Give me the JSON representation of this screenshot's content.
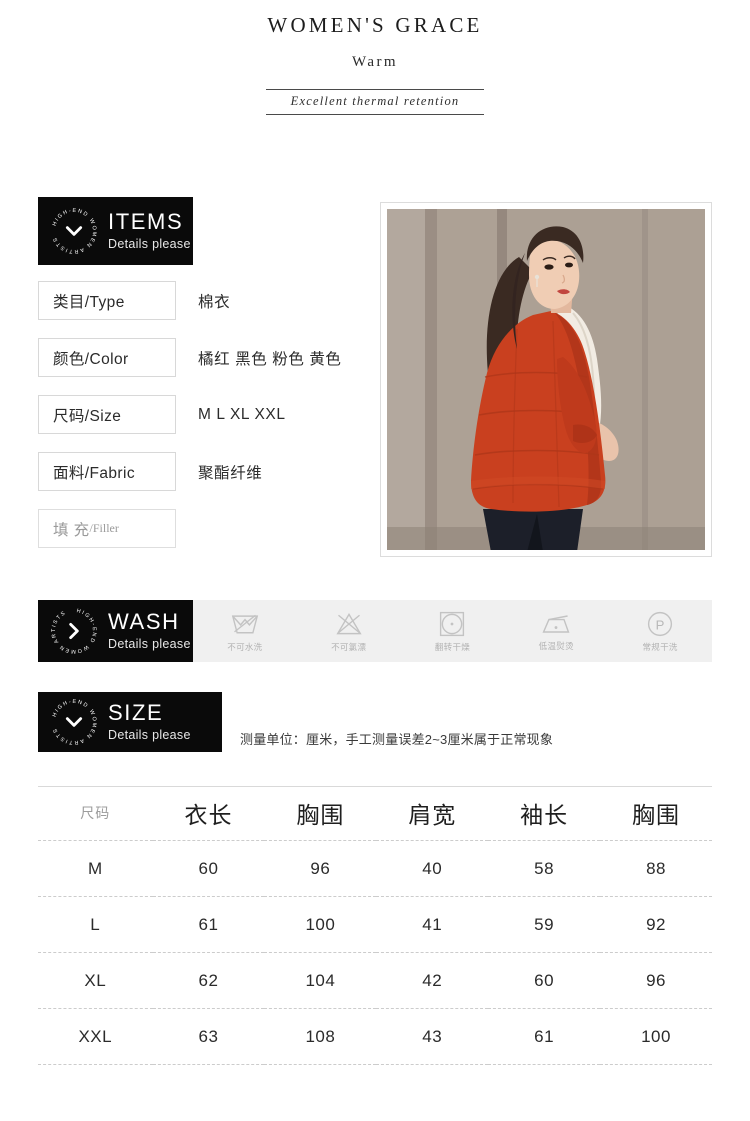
{
  "header": {
    "title": "WOMEN'S GRACE",
    "subtitle": "Warm",
    "tagline": "Excellent thermal retention"
  },
  "items": {
    "badge": {
      "title": "ITEMS",
      "subtitle": "Details please",
      "seal_text": "HIGH-END WOMEN ARTISTS",
      "icon": "chevron-down-icon"
    },
    "specs": [
      {
        "key": "类目/Type",
        "value": "棉衣"
      },
      {
        "key": "颜色/Color",
        "value": "橘红 黑色 粉色 黄色"
      },
      {
        "key": "尺码/Size",
        "value": "M L XL XXL"
      },
      {
        "key": "面料/Fabric",
        "value": "聚酯纤维"
      }
    ],
    "filler_row": {
      "key_cn": "填 充",
      "key_en": "/Filler",
      "value": ""
    }
  },
  "photo": {
    "alt": "model-wearing-orange-padded-jacket",
    "jacket_color": "#c9401f",
    "background_color": "#a89b90",
    "pants_color": "#1c1f29",
    "hair_color": "#3a2a22",
    "fur_color": "#f5f1ea"
  },
  "wash": {
    "badge": {
      "title": "WASH",
      "subtitle": "Details please",
      "seal_text": "HIGH-END WOMEN ARTISTS",
      "icon": "chevron-right-icon"
    },
    "icons": [
      {
        "name": "do-not-wash-icon",
        "label": "不可水洗"
      },
      {
        "name": "do-not-bleach-icon",
        "label": "不可氯漂"
      },
      {
        "name": "tumble-dry-icon",
        "label": "翻转干燥"
      },
      {
        "name": "low-temp-iron-icon",
        "label": "低温熨烫"
      },
      {
        "name": "dry-clean-p-icon",
        "label": "常规干洗"
      }
    ]
  },
  "size": {
    "badge": {
      "title": "SIZE",
      "subtitle": "Details please",
      "seal_text": "HIGH-END WOMEN ARTISTS",
      "icon": "chevron-down-icon"
    },
    "note": "测量单位：厘米，手工测量误差2~3厘米属于正常现象",
    "table": {
      "headers": [
        "尺码",
        "衣长",
        "胸围",
        "肩宽",
        "袖长",
        "胸围"
      ],
      "rows": [
        [
          "M",
          "60",
          "96",
          "40",
          "58",
          "88"
        ],
        [
          "L",
          "61",
          "100",
          "41",
          "59",
          "92"
        ],
        [
          "XL",
          "62",
          "104",
          "42",
          "60",
          "96"
        ],
        [
          "XXL",
          "63",
          "108",
          "43",
          "61",
          "100"
        ]
      ]
    }
  }
}
